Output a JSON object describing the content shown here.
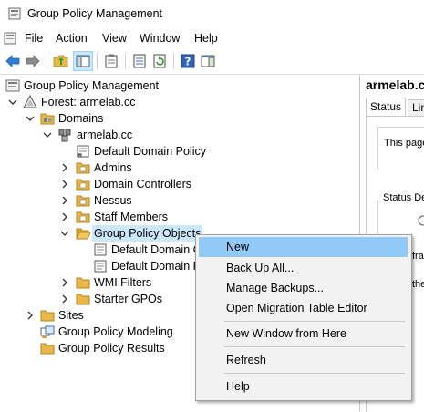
{
  "window": {
    "title": "Group Policy Management"
  },
  "menu": [
    "File",
    "Action",
    "View",
    "Window",
    "Help"
  ],
  "toolbar": {
    "icons": [
      "back-arrow-icon",
      "forward-arrow-icon",
      "up-folder-icon",
      "show-hide-tree-icon",
      "clipboard-icon",
      "export-list-icon",
      "refresh-icon",
      "help-icon",
      "properties-pane-icon"
    ]
  },
  "tree": {
    "root": "Group Policy Management",
    "forest": "Forest: armelab.cc",
    "domains": "Domains",
    "domain": "armelab.cc",
    "default_domain_policy": "Default Domain Policy",
    "ou_admins": "Admins",
    "ou_domain_controllers": "Domain Controllers",
    "ou_nessus": "Nessus",
    "ou_staff_members": "Staff Members",
    "gpo_container": "Group Policy Objects",
    "gpo_child_1": "Default Domain C",
    "gpo_child_2": "Default Domain P",
    "wmi_filters": "WMI Filters",
    "starter_gpos": "Starter GPOs",
    "sites": "Sites",
    "modeling": "Group Policy Modeling",
    "results": "Group Policy Results"
  },
  "right_pane": {
    "header": "armelab.c",
    "tab_status": "Status",
    "tab_linked": "Lin",
    "info_text": "This page",
    "status_label": "Status De",
    "infra_text": "frast",
    "partial_text": "the"
  },
  "context_menu": {
    "items": [
      "New",
      "Back Up All...",
      "Manage Backups...",
      "Open Migration Table Editor",
      "New Window from Here",
      "Refresh",
      "Help"
    ]
  },
  "colors": {
    "highlight": "#91c9f7",
    "selection": "#cce8ff",
    "folder": "#e8b84a"
  }
}
